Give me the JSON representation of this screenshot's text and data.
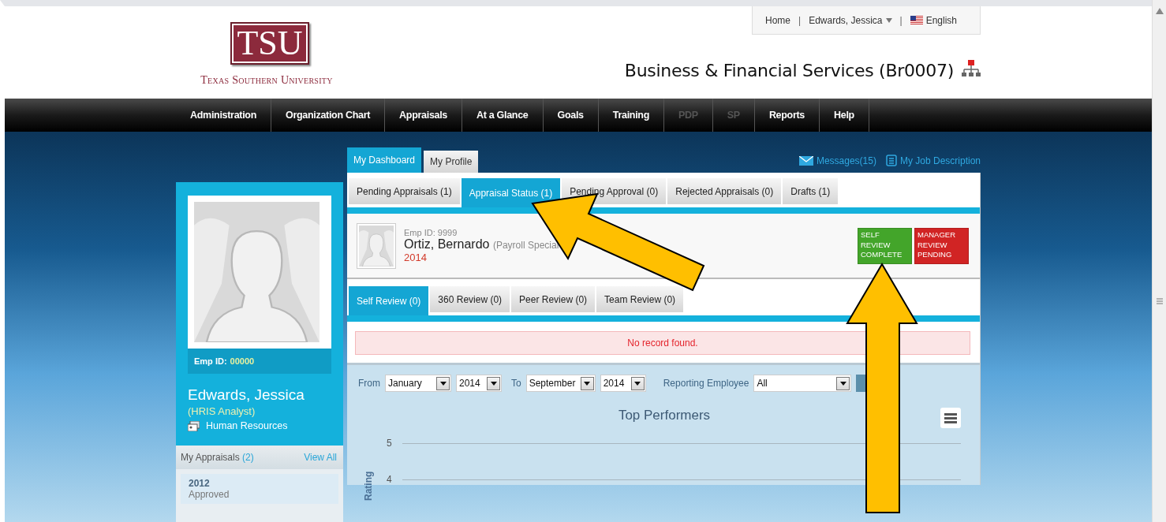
{
  "header": {
    "logo": {
      "mark": "TSU",
      "name": "Texas Southern University"
    },
    "utility_links": [
      {
        "label": "Home",
        "kind": "link"
      },
      {
        "label": "Edwards, Jessica",
        "kind": "menu"
      },
      {
        "label": "English",
        "kind": "language"
      }
    ],
    "separator": "|",
    "title": "Business & Financial Services (Br0007)"
  },
  "nav": [
    {
      "label": "Administration",
      "disabled": false
    },
    {
      "label": "Organization Chart",
      "disabled": false
    },
    {
      "label": "Appraisals",
      "disabled": false
    },
    {
      "label": "At a Glance",
      "disabled": false
    },
    {
      "label": "Goals",
      "disabled": false
    },
    {
      "label": "Training",
      "disabled": false
    },
    {
      "label": "PDP",
      "disabled": true
    },
    {
      "label": "SP",
      "disabled": true
    },
    {
      "label": "Reports",
      "disabled": false
    },
    {
      "label": "Help",
      "disabled": false
    }
  ],
  "profile": {
    "emp_id_label": "Emp ID:",
    "emp_id": "00000",
    "name": "Edwards, Jessica",
    "title": "(HRIS Analyst)",
    "department": "Human Resources",
    "appraisals": {
      "heading": "My Appraisals",
      "count": "(2)",
      "view_all": "View All",
      "items": [
        {
          "year": "2012",
          "status": "Approved"
        }
      ]
    }
  },
  "main_tabs": [
    {
      "label": "My Dashboard",
      "selected": true
    },
    {
      "label": "My Profile",
      "selected": false
    }
  ],
  "links": [
    {
      "label": "Messages(15)",
      "kind": "messages"
    },
    {
      "label": "My Job Description",
      "kind": "job"
    }
  ],
  "appraisal_tabs": [
    {
      "label": "Pending Appraisals (1)",
      "selected": false
    },
    {
      "label": "Appraisal Status (1)",
      "selected": true
    },
    {
      "label": "Pending Approval (0)",
      "selected": false
    },
    {
      "label": "Rejected Appraisals (0)",
      "selected": false
    },
    {
      "label": "Drafts (1)",
      "selected": false
    }
  ],
  "employee": {
    "emp_id": "Emp ID: 9999",
    "name": "Ortiz, Bernardo",
    "role": "(Payroll Special",
    "year": "2014",
    "badges": [
      {
        "label": "SELF REVIEW COMPLETE",
        "color": "#43a52a"
      },
      {
        "label": "MANAGER REVIEW PENDING",
        "color": "#d12424"
      }
    ]
  },
  "review_tabs": [
    {
      "label": "Self Review (0)",
      "selected": true
    },
    {
      "label": "360 Review (0)",
      "selected": false
    },
    {
      "label": "Peer Review (0)",
      "selected": false
    },
    {
      "label": "Team Review (0)",
      "selected": false
    }
  ],
  "alert": "No record found.",
  "filters": {
    "from_label": "From",
    "from_month": "January",
    "from_year": "2014",
    "to_label": "To",
    "to_month": "September",
    "to_year": "2014",
    "employee_label": "Reporting Employee",
    "employee": "All"
  },
  "chart": {
    "title": "Top Performers",
    "ylabel": "Rating",
    "yticks": [
      "5",
      "4"
    ]
  }
}
